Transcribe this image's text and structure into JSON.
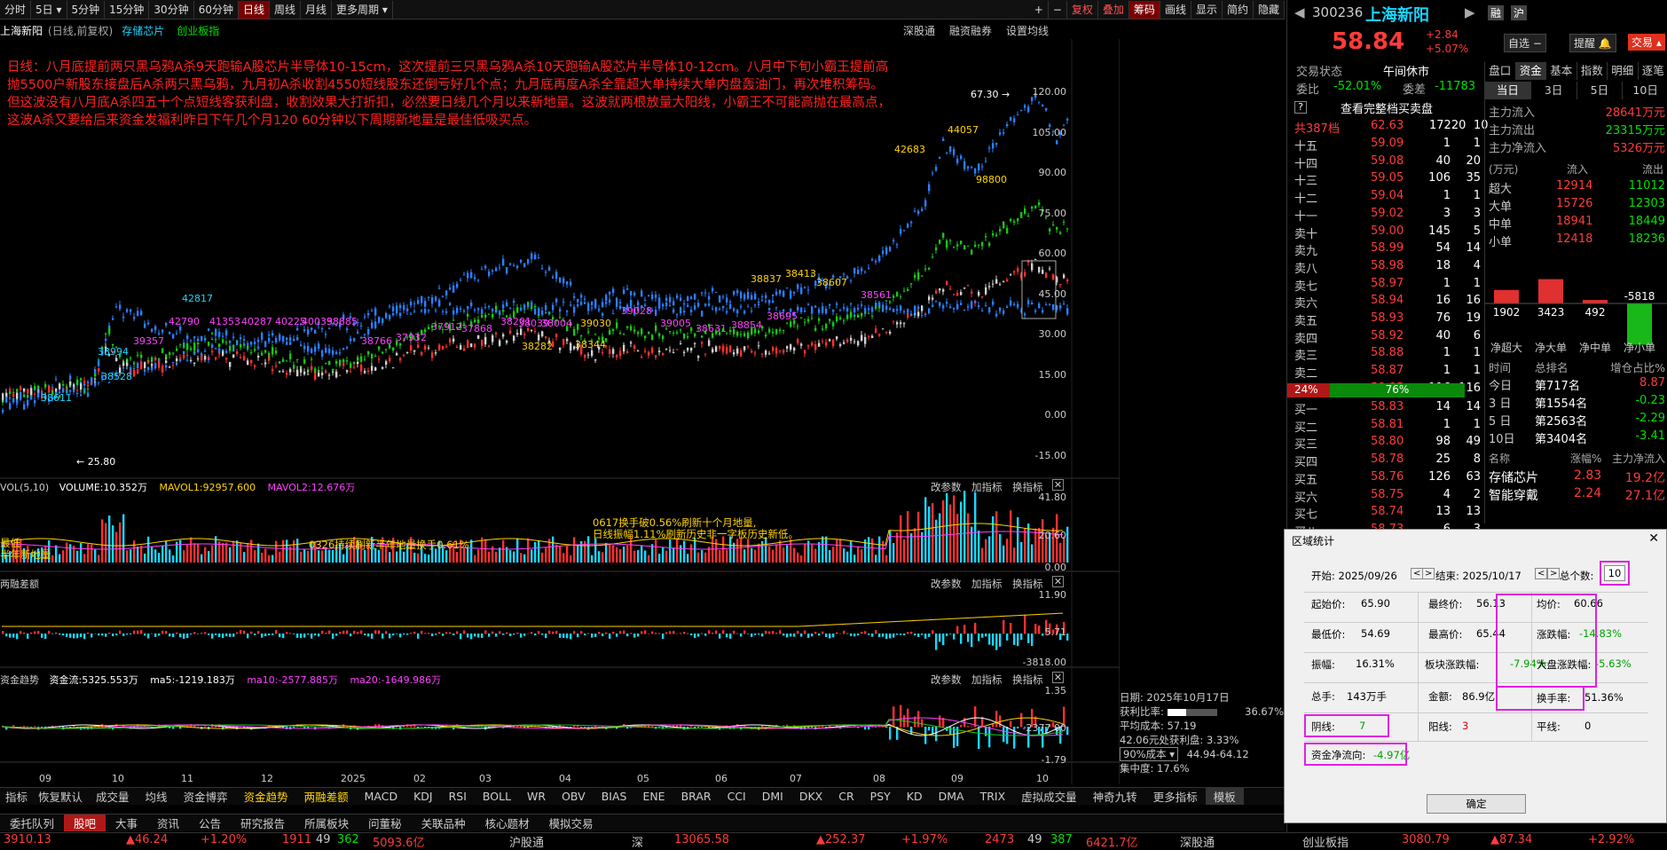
{
  "toolbar": {
    "items": [
      "分时",
      "5日",
      "5分钟",
      "15分钟",
      "30分钟",
      "60分钟",
      "日线",
      "周线",
      "月线",
      "更多周期"
    ],
    "right": [
      "复权",
      "叠加",
      "筹码",
      "画线",
      "显示",
      "简约",
      "隐藏"
    ]
  },
  "header": {
    "title": "上海新阳",
    "sub": "(日线,前复权)",
    "tag1": "存储芯片",
    "tag2": "创业板指",
    "btns": [
      "深股通",
      "融资融券",
      "设置均线"
    ]
  },
  "note": "日线：八月底提前两只黑乌鸦A杀9天跑输A股芯片半导体10-15cm，这次提前三只黑乌鸦A杀10天跑输A股芯片半导体10-12cm。八月中下旬小霸王提前高抛5500户新股东接盘后A杀两只黑乌鸦，九月初A杀收割4550短线股东还倒亏好几个点；九月底再度A杀全靠超大单持续大单内盘轰油门，再次堆积筹码。但这波没有八月底A杀四五十个点短线客获利盘，收割效果大打折扣，必然要日线几个月以来新地量。这波就两根放量大阳线，小霸王不可能高抛在最高点，这波A杀又要给后来资金发福利昨日下午几个月120 60分钟以下周期新地量是最佳低吸买点。",
  "price_axis": [
    "120.00",
    "105.00",
    "90.00",
    "75.00",
    "60.00",
    "45.00",
    "30.00",
    "15.00",
    "0.00",
    "-15.00"
  ],
  "annotations_purple": [
    "39357",
    "42790",
    "41353",
    "40287",
    "40225",
    "40039",
    "38885",
    "38766",
    "37932",
    "37912",
    "37868",
    "38201",
    "38039",
    "38004",
    "39028",
    "39005",
    "38631",
    "38854",
    "38695",
    "38561"
  ],
  "annotations_yellow": [
    "38282",
    "38344",
    "39030",
    "38837",
    "38413",
    "38607",
    "44057",
    "42683",
    "98800"
  ],
  "annotations_green": [
    "42817",
    "38528",
    "38611",
    "38994"
  ],
  "price_labels": {
    "high": "67.30",
    "low": "25.80"
  },
  "vol": {
    "title": "VOL(5,10)",
    "volume": "VOLUME:10.352万",
    "mavol1": "MAVOL1:92957.600",
    "mavol2": "MAVOL2:12.676万",
    "axis": [
      "41.80",
      "20.60",
      "0.00"
    ],
    "note1": "0617换手破0.56%刷新十个月地量,",
    "note2": "日线振幅1.11%刷新历史非一字板历史新低。",
    "note3": "0326持续刷新半年地量换手0.61%",
    "note4": "最低",
    "note5": "半年新地量"
  },
  "mr": {
    "title": "两融差额",
    "axis": [
      "11.90",
      "5.71",
      "-3818.00"
    ]
  },
  "ff": {
    "title": "资金趋势",
    "v1": "资金流:5325.553万",
    "v2": "ma5:-1219.183万",
    "v3": "ma10:-2577.885万",
    "v4": "ma20:-1649.986万",
    "axis": [
      "1.35",
      "-2377.00",
      "-1.79"
    ]
  },
  "panel_btns": [
    "改参数",
    "加指标",
    "换指标"
  ],
  "time_axis": [
    "09",
    "10",
    "11",
    "12",
    "2025",
    "02",
    "03",
    "04",
    "05",
    "06",
    "07",
    "08",
    "09",
    "10"
  ],
  "chip": {
    "date": "日期: 2025年10月17日",
    "ratio_label": "获利比率:",
    "ratio": "36.67%",
    "avg": "平均成本: 57.19",
    "profit": "42.06元处获利盘: 3.33%",
    "cost": "90%成本",
    "range": "44.94-64.12",
    "conc": "集中度: 17.6%"
  },
  "ind_tabs": [
    "指标",
    "恢复默认",
    "成交量",
    "均线",
    "资金博弈",
    "资金趋势",
    "两融差额",
    "MACD",
    "KDJ",
    "RSI",
    "BOLL",
    "WR",
    "OBV",
    "BIAS",
    "ENE",
    "BRAR",
    "CCI",
    "DMI",
    "DKX",
    "CR",
    "PSY",
    "KD",
    "DMA",
    "TRIX",
    "虚拟成交量",
    "神奇九转",
    "更多指标",
    "模板"
  ],
  "bottom_tabs": [
    "委托队列",
    "股吧",
    "大事",
    "资讯",
    "公告",
    "研究报告",
    "所属板块",
    "问董秘",
    "关联品种",
    "核心题材",
    "模拟交易"
  ],
  "ticker": [
    "3910.13",
    "▲46.24",
    "+1.20%",
    "1911",
    "49",
    "362",
    "5093.6亿",
    "沪股通",
    "深",
    "13065.58",
    "▲252.37",
    "+1.97%",
    "2473",
    "49",
    "387",
    "6421.7亿",
    "深股通",
    "创业板指",
    "3080.79",
    "▲87.34",
    "+2.92%"
  ],
  "stock": {
    "code": "300236",
    "name": "上海新阳",
    "b1": "融",
    "b2": "沪",
    "price": "58.84",
    "chg": "+2.84",
    "pct": "+5.07%",
    "zx": "自选",
    "tx": "提醒",
    "jy": "交易"
  },
  "status": {
    "label": "交易状态",
    "value": "午间休市",
    "wb_label": "委比",
    "wb": "-52.01%",
    "wc_label": "委差",
    "wc": "-11783"
  },
  "full_book": "查看完整档买卖盘",
  "total": {
    "label": "共387档",
    "price": "62.63",
    "vol": "17220",
    "n": "10"
  },
  "asks": [
    [
      "十五",
      "59.09",
      "1",
      "1"
    ],
    [
      "十四",
      "59.08",
      "40",
      "20"
    ],
    [
      "十三",
      "59.05",
      "106",
      "35"
    ],
    [
      "十二",
      "59.04",
      "1",
      "1"
    ],
    [
      "十一",
      "59.02",
      "3",
      "3"
    ],
    [
      "卖十",
      "59.00",
      "145",
      "5"
    ],
    [
      "卖九",
      "58.99",
      "54",
      "14"
    ],
    [
      "卖八",
      "58.98",
      "18",
      "4"
    ],
    [
      "卖七",
      "58.97",
      "1",
      "1"
    ],
    [
      "卖六",
      "58.94",
      "16",
      "16"
    ],
    [
      "卖五",
      "58.93",
      "76",
      "19"
    ],
    [
      "卖四",
      "58.92",
      "40",
      "6"
    ],
    [
      "卖三",
      "58.88",
      "1",
      "1"
    ],
    [
      "卖二",
      "58.87",
      "1",
      "1"
    ],
    [
      "卖一",
      "58.85",
      "116",
      "116"
    ]
  ],
  "ratio": {
    "buy": "24%",
    "sell": "76%"
  },
  "bids": [
    [
      "买一",
      "58.83",
      "14",
      "14"
    ],
    [
      "买二",
      "58.81",
      "1",
      "1"
    ],
    [
      "买三",
      "58.80",
      "98",
      "49"
    ],
    [
      "买四",
      "58.78",
      "25",
      "8"
    ],
    [
      "买五",
      "58.76",
      "126",
      "63"
    ],
    [
      "买六",
      "58.75",
      "4",
      "2"
    ],
    [
      "买七",
      "58.74",
      "13",
      "13"
    ],
    [
      "买八",
      "58.73",
      "6",
      "3"
    ]
  ],
  "fund_tabs": [
    "盘口",
    "资金",
    "基本",
    "指数",
    "明细",
    "逐笔"
  ],
  "day_tabs": [
    "当日",
    "3日",
    "5日",
    "10日"
  ],
  "flow": {
    "in_label": "主力流入",
    "in": "28641万元",
    "out_label": "主力流出",
    "out": "23315万元",
    "net_label": "主力净流入",
    "net": "5326万元"
  },
  "flow_tbl": {
    "unit": "(万元)",
    "h1": "流入",
    "h2": "流出",
    "rows": [
      [
        "超大",
        "12914",
        "11012"
      ],
      [
        "大单",
        "15726",
        "12303"
      ],
      [
        "中单",
        "18941",
        "18449"
      ],
      [
        "小单",
        "12418",
        "18236"
      ]
    ]
  },
  "flow_bars": {
    "values": [
      1902,
      3423,
      492,
      -5818
    ],
    "labels": [
      "净超大",
      "净大单",
      "净中单",
      "净小单"
    ],
    "texts": [
      "1902",
      "3423",
      "492",
      "-5818"
    ]
  },
  "rank": {
    "h": [
      "时间",
      "总排名",
      "增仓占比%"
    ],
    "rows": [
      [
        "今日",
        "第717名",
        "8.87"
      ],
      [
        "3 日",
        "第1554名",
        "-0.23"
      ],
      [
        "5 日",
        "第2563名",
        "-2.29"
      ],
      [
        "10日",
        "第3404名",
        "-3.41"
      ]
    ]
  },
  "sector": {
    "h": [
      "名称",
      "涨幅%",
      "主力净流入"
    ],
    "rows": [
      [
        "存储芯片",
        "2.83",
        "19.2亿"
      ],
      [
        "智能穿戴",
        "2.24",
        "27.1亿"
      ]
    ]
  },
  "dialog": {
    "title": "区域统计",
    "start_l": "开始:",
    "start": "2025/09/26",
    "end_l": "结束:",
    "end": "2025/10/17",
    "count_l": "总个数:",
    "count": "10",
    "open_l": "起始价:",
    "open": "65.90",
    "close_l": "最终价:",
    "close": "56.13",
    "avg_l": "均价:",
    "avg": "60.66",
    "low_l": "最低价:",
    "low": "54.69",
    "high_l": "最高价:",
    "high": "65.44",
    "chg_l": "涨跌幅:",
    "chg": "-14.83%",
    "amp_l": "振幅:",
    "amp": "16.31%",
    "sec_l": "板块涨跌幅:",
    "sec": "-7.94%",
    "mkt_l": "大盘涨跌幅:",
    "mkt": "-5.63%",
    "hand_l": "总手:",
    "hand": "143万手",
    "amt_l": "金额:",
    "amt": "86.9亿",
    "turn_l": "换手率:",
    "turn": "51.36%",
    "yin_l": "阴线:",
    "yin": "7",
    "yang_l": "阳线:",
    "yang": "3",
    "flat_l": "平线:",
    "flat": "0",
    "flow_l": "资金净流向:",
    "flow": "-4.97亿",
    "ok": "确定"
  }
}
